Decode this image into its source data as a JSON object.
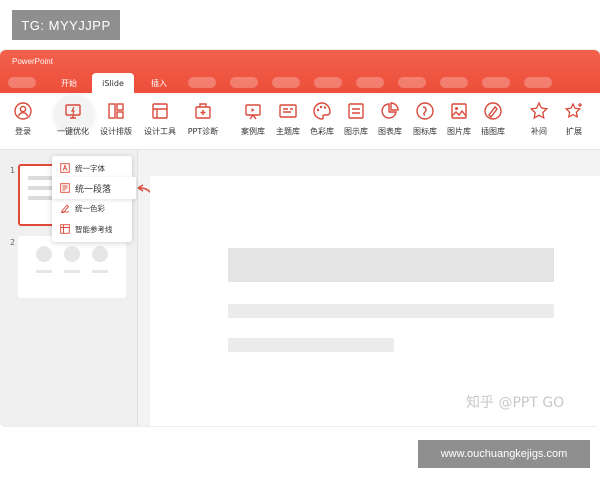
{
  "overlay": {
    "top_badge": "TG: MYYJJPP",
    "bottom_badge": "www.ouchuangkejigs.com",
    "watermark": "知乎 @PPT GO"
  },
  "app": {
    "title": "PowerPoint"
  },
  "tabs": [
    {
      "label": "开始"
    },
    {
      "label": "iSlide",
      "active": true
    },
    {
      "label": "插入"
    }
  ],
  "ribbon": {
    "tools": [
      {
        "label": "登录",
        "icon": "user-icon"
      },
      {
        "label": "一键优化",
        "icon": "monitor-optimize-icon"
      },
      {
        "label": "设计排版",
        "icon": "layout-icon"
      },
      {
        "label": "设计工具",
        "icon": "design-tool-icon"
      },
      {
        "label": "PPT诊断",
        "icon": "medical-kit-icon"
      },
      {
        "label": "案例库",
        "icon": "presentation-icon"
      },
      {
        "label": "主题库",
        "icon": "theme-icon"
      },
      {
        "label": "色彩库",
        "icon": "palette-icon"
      },
      {
        "label": "图示库",
        "icon": "diagram-icon"
      },
      {
        "label": "图表库",
        "icon": "pie-chart-icon"
      },
      {
        "label": "图标库",
        "icon": "icon-library-icon"
      },
      {
        "label": "图片库",
        "icon": "image-icon"
      },
      {
        "label": "插图库",
        "icon": "illustration-icon"
      },
      {
        "label": "补间",
        "icon": "star-icon"
      },
      {
        "label": "扩展",
        "icon": "star-plus-icon"
      }
    ]
  },
  "dropdown": {
    "items": [
      {
        "label": "统一字体",
        "icon": "font-icon"
      },
      {
        "label": "统一段落",
        "icon": "paragraph-icon",
        "active": true
      },
      {
        "label": "统一色彩",
        "icon": "color-icon"
      },
      {
        "label": "智能参考线",
        "icon": "guides-icon"
      }
    ]
  },
  "slides": [
    {
      "number": "1"
    },
    {
      "number": "2"
    }
  ],
  "colors": {
    "accent": "#e9442f",
    "icon": "#d9493a"
  }
}
